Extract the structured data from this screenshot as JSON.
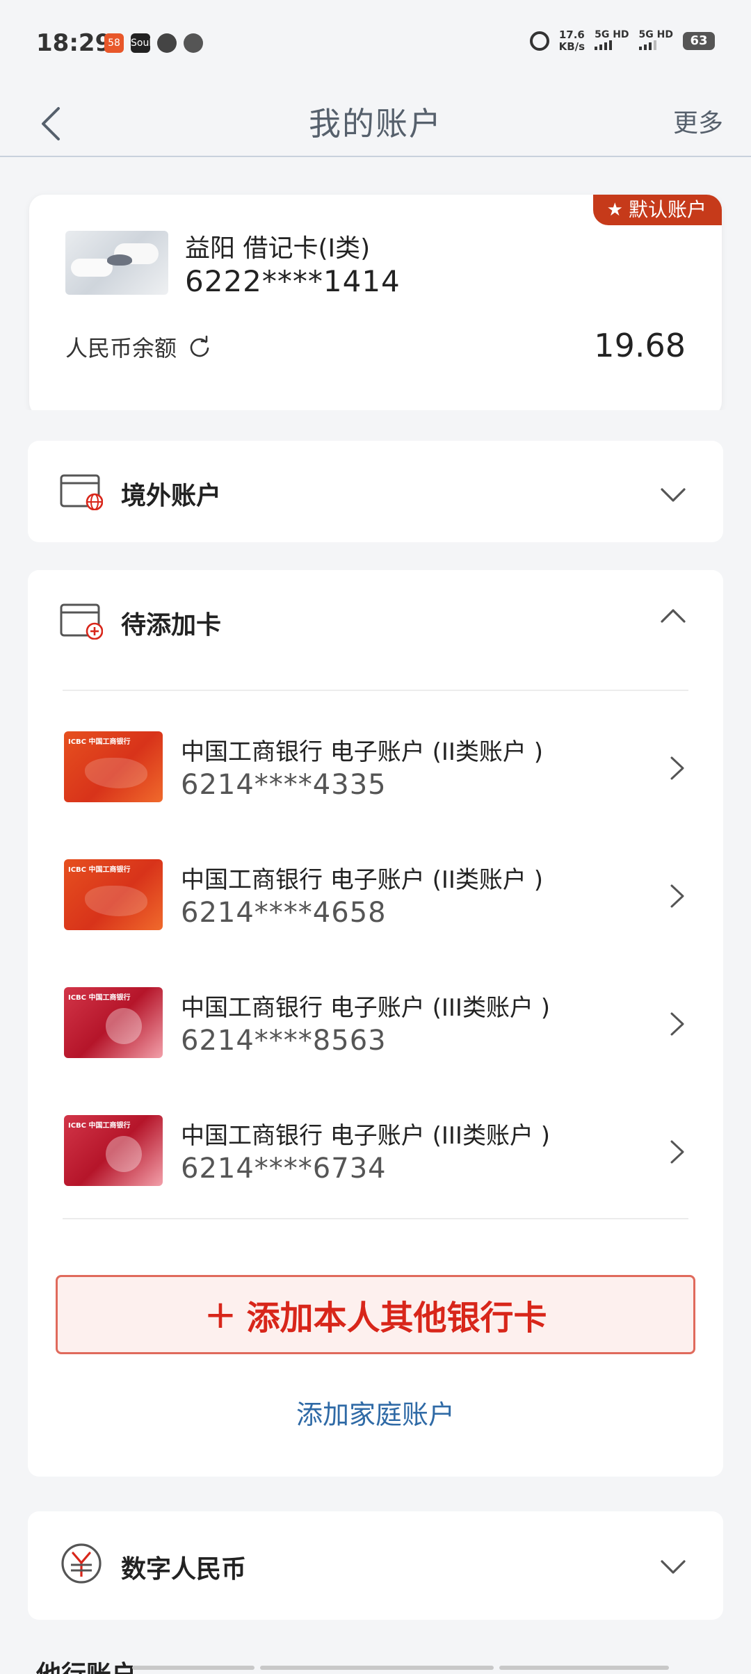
{
  "status_bar": {
    "time": "18:29",
    "apps": [
      "58",
      "Soul",
      "",
      ""
    ],
    "network_speed": "17.6",
    "network_speed_unit": "KB/s",
    "sim1": "5G HD",
    "sim2": "5G HD",
    "battery": "63"
  },
  "nav": {
    "title": "我的账户",
    "more_label": "更多"
  },
  "default_account": {
    "badge_label": "默认账户",
    "card_name": "益阳 借记卡(Ⅰ类)",
    "card_number": "6222****1414",
    "balance_label": "人民币余额",
    "balance_value": "19.68"
  },
  "sections": {
    "overseas": {
      "title": "境外账户"
    },
    "pending": {
      "title": "待添加卡"
    },
    "digital_rmb": {
      "title": "数字人民币"
    },
    "other_bank": {
      "title": "他行账户"
    }
  },
  "pending_cards": [
    {
      "name": "中国工商银行 电子账户 (II类账户 )",
      "number": "6214****4335",
      "style": "orange"
    },
    {
      "name": "中国工商银行 电子账户 (II类账户 )",
      "number": "6214****4658",
      "style": "orange"
    },
    {
      "name": "中国工商银行 电子账户 (III类账户 )",
      "number": "6214****8563",
      "style": "crimson"
    },
    {
      "name": "中国工商银行 电子账户 (III类账户 )",
      "number": "6214****6734",
      "style": "crimson"
    }
  ],
  "actions": {
    "add_card_label": "添加本人其他银行卡",
    "add_family_label": "添加家庭账户"
  },
  "colors": {
    "accent_red": "#d8261a",
    "badge_red": "#c63a1a",
    "link_blue": "#2f6aa6"
  }
}
